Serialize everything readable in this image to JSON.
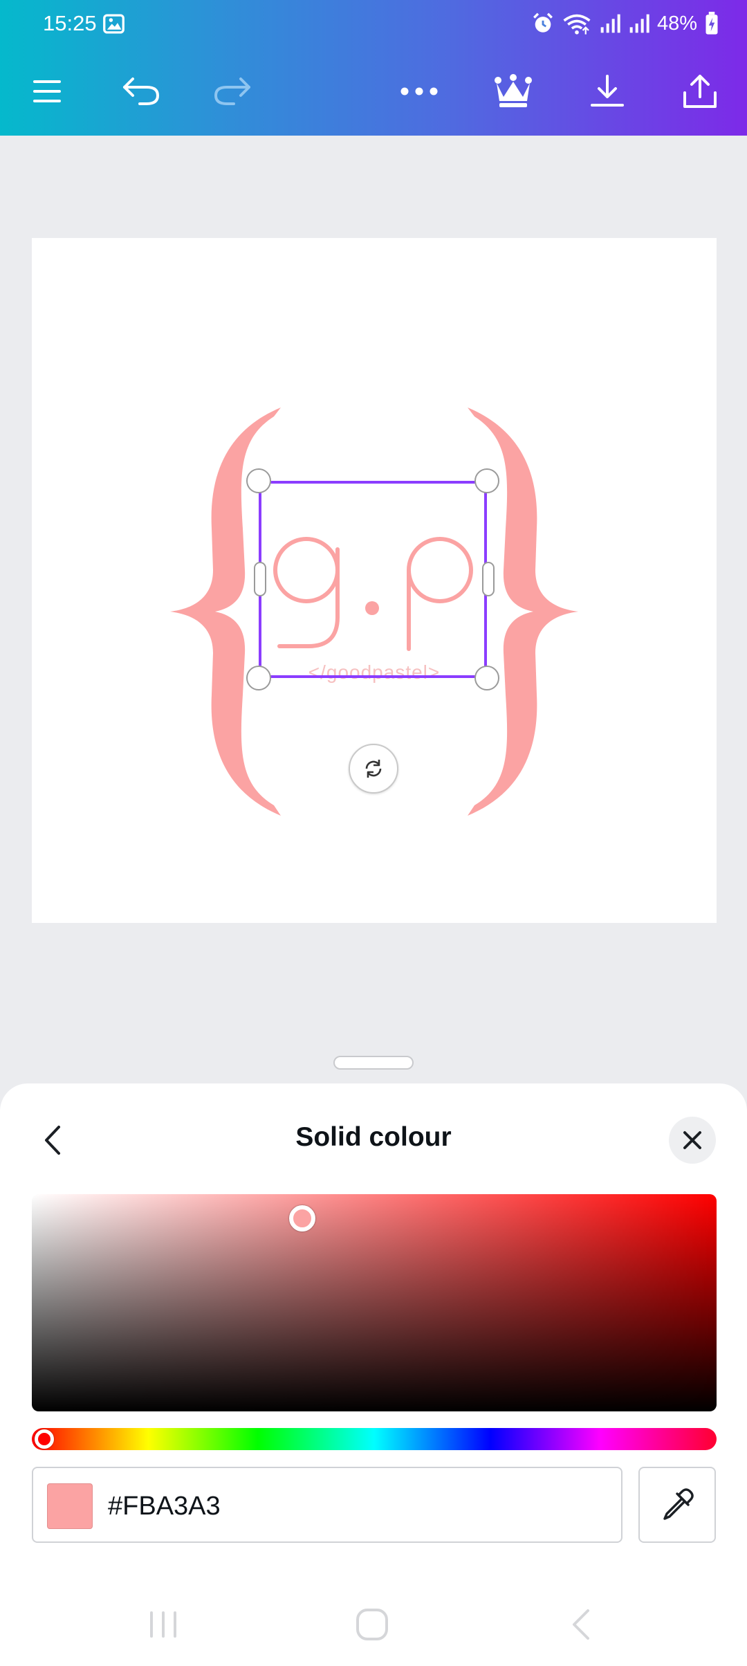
{
  "status_bar": {
    "time": "15:25",
    "battery": "48%"
  },
  "toolbar": {
    "menu_icon": "menu-icon",
    "undo_icon": "undo-icon",
    "redo_icon": "redo-icon",
    "more_icon": "more-icon",
    "premium_icon": "crown-icon",
    "download_icon": "download-icon",
    "share_icon": "share-icon"
  },
  "design": {
    "logo_letters": "g.p",
    "tagline": "</goodpastel>",
    "logo_color": "#FBA3A3"
  },
  "color_sheet": {
    "title": "Solid colour",
    "hex_value": "#FBA3A3",
    "hue": 0,
    "saturation": 0.36,
    "value": 0.98
  },
  "colors": {
    "accent": "#8B3DFF",
    "gradient_start": "#05B9CC",
    "gradient_end": "#7D2AE8"
  }
}
